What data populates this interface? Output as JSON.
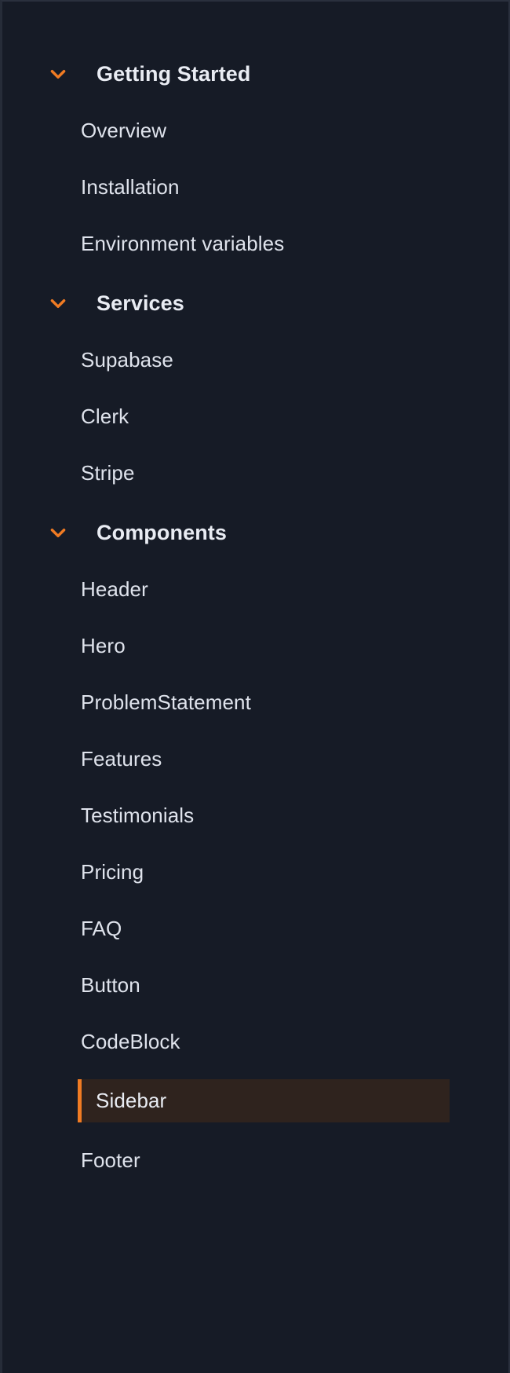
{
  "theme": {
    "panel_bg": "#161b26",
    "panel_border": "#2a303d",
    "accent": "#f07b23",
    "active_bg": "#2f231e",
    "text": "#dfe3ec",
    "heading_text": "#e9ecf3"
  },
  "sidebar": {
    "active_item": "Sidebar",
    "groups": [
      {
        "title": "Getting Started",
        "expanded": true,
        "chevron": "chevron-down-icon",
        "items": [
          {
            "label": "Overview"
          },
          {
            "label": "Installation"
          },
          {
            "label": "Environment variables"
          }
        ]
      },
      {
        "title": "Services",
        "expanded": true,
        "chevron": "chevron-down-icon",
        "items": [
          {
            "label": "Supabase"
          },
          {
            "label": "Clerk"
          },
          {
            "label": "Stripe"
          }
        ]
      },
      {
        "title": "Components",
        "expanded": true,
        "chevron": "chevron-down-icon",
        "items": [
          {
            "label": "Header"
          },
          {
            "label": "Hero"
          },
          {
            "label": "ProblemStatement"
          },
          {
            "label": "Features"
          },
          {
            "label": "Testimonials"
          },
          {
            "label": "Pricing"
          },
          {
            "label": "FAQ"
          },
          {
            "label": "Button"
          },
          {
            "label": "CodeBlock"
          },
          {
            "label": "Sidebar"
          },
          {
            "label": "Footer"
          }
        ]
      }
    ]
  }
}
